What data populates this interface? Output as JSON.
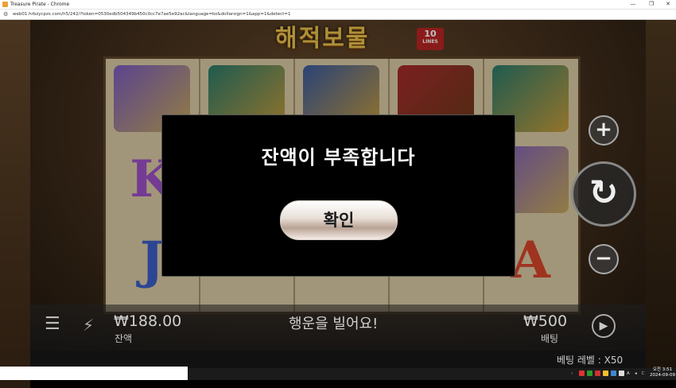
{
  "window": {
    "title": "Treasure Pirate - Chrome",
    "min": "—",
    "restore": "❐",
    "close": "✕"
  },
  "address": {
    "url": "web01.hrbzycpzs.com/h5/242/?token=0530edb504349b450c0cc7e7ae5e92ac&language=ko&dollarsign=1&app=1&detect=1"
  },
  "game": {
    "logo": "해적보물",
    "lines_number": "10",
    "lines_label": "LINES",
    "symbols": {
      "row2_col1": "K",
      "row3_col1": "J",
      "row3_col5": "A"
    },
    "balance_amount": "₩188.00",
    "balance_label": "잔액",
    "good_luck": "행운을 빌어요!",
    "bet_amount": "₩500",
    "bet_label": "배팅",
    "bet_level": "베팅 레벨 : X50",
    "plus": "+",
    "minus": "−",
    "spin": "↻",
    "autoplay": "▶",
    "menu": "☰",
    "turbo": "⚡"
  },
  "modal": {
    "message": "잔액이 부족합니다",
    "ok_label": "확인"
  },
  "taskbar": {
    "time": "오전 3:51",
    "date": "2024-09-09",
    "lang": "A",
    "ime": "ㄷ"
  },
  "colors": {
    "accent": "#b82424",
    "logo_gold": "#e8c04a",
    "modal_bg": "#000000"
  }
}
